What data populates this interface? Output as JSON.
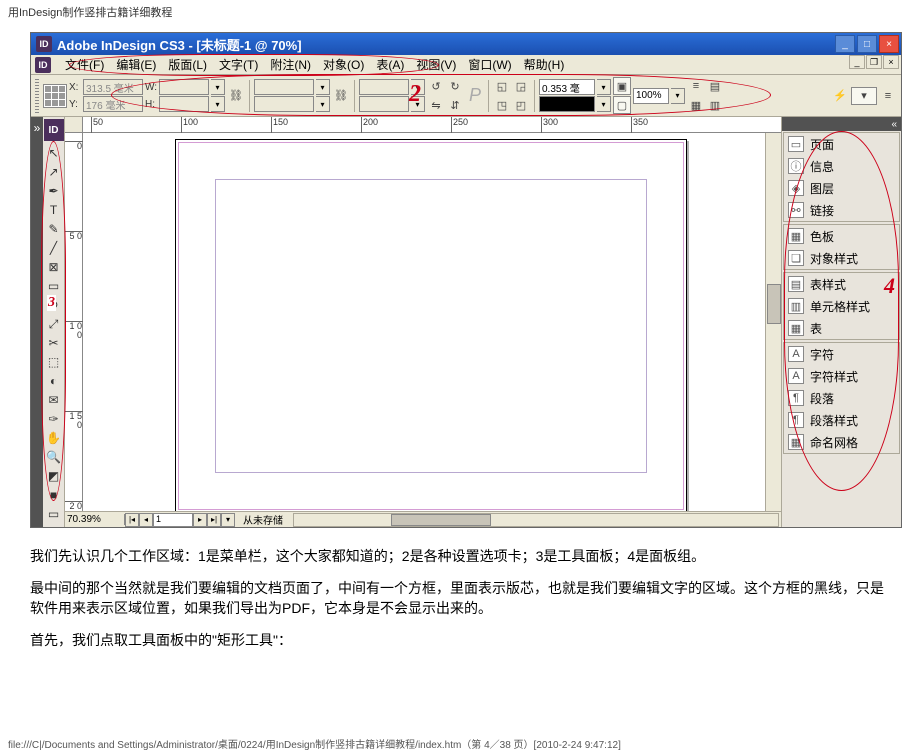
{
  "page_title": "用InDesign制作竖排古籍详细教程",
  "titlebar": {
    "app_name": "Adobe InDesign CS3 - [未标题-1 @ 70%]"
  },
  "win_controls": {
    "min": "_",
    "max": "□",
    "close": "×"
  },
  "mdi_controls": {
    "min": "_",
    "restore": "❐",
    "close": "×"
  },
  "menu": [
    "文件(F)",
    "编辑(E)",
    "版面(L)",
    "文字(T)",
    "附注(N)",
    "对象(O)",
    "表(A)",
    "视图(V)",
    "窗口(W)",
    "帮助(H)"
  ],
  "toolbar": {
    "x_label": "X:",
    "x_value": "313.5 毫米",
    "y_label": "Y:",
    "y_value": "176 毫米",
    "w_label": "W:",
    "w_value": "",
    "h_label": "H:",
    "h_value": "",
    "opt_value": "0.353 毫",
    "zoom": "100%",
    "annotation": "2"
  },
  "ruler_h": [
    {
      "pos": 8,
      "label": "50"
    },
    {
      "pos": 98,
      "label": "100"
    },
    {
      "pos": 188,
      "label": "150"
    },
    {
      "pos": 278,
      "label": "200"
    },
    {
      "pos": 368,
      "label": "250"
    },
    {
      "pos": 458,
      "label": "300"
    },
    {
      "pos": 548,
      "label": "350"
    }
  ],
  "ruler_v": [
    {
      "pos": 8,
      "label": "0"
    },
    {
      "pos": 98,
      "label": "5\n0"
    },
    {
      "pos": 188,
      "label": "1\n0\n0"
    },
    {
      "pos": 278,
      "label": "1\n5\n0"
    },
    {
      "pos": 368,
      "label": "2\n0\n0"
    }
  ],
  "statusbar": {
    "zoom": "70.39%",
    "page": "1",
    "status": "从未存储"
  },
  "panels": {
    "group1": [
      {
        "icon": "▭",
        "label": "页面"
      },
      {
        "icon": "ⓘ",
        "label": "信息"
      },
      {
        "icon": "◈",
        "label": "图层"
      },
      {
        "icon": "⚯",
        "label": "链接"
      }
    ],
    "group2": [
      {
        "icon": "▦",
        "label": "色板"
      },
      {
        "icon": "❏",
        "label": "对象样式"
      }
    ],
    "group3": [
      {
        "icon": "▤",
        "label": "表样式"
      },
      {
        "icon": "▥",
        "label": "单元格样式"
      },
      {
        "icon": "▦",
        "label": "表"
      }
    ],
    "group4": [
      {
        "icon": "A",
        "label": "字符"
      },
      {
        "icon": "A",
        "label": "字符样式"
      },
      {
        "icon": "¶",
        "label": "段落"
      },
      {
        "icon": "¶",
        "label": "段落样式"
      },
      {
        "icon": "▦",
        "label": "命名网格"
      }
    ]
  },
  "annotations": {
    "marker2": "2",
    "marker3": "3",
    "marker4": "4"
  },
  "article": {
    "p1": "我们先认识几个工作区域：1是菜单栏，这个大家都知道的；2是各种设置选项卡；3是工具面板；4是面板组。",
    "p2": "最中间的那个当然就是我们要编辑的文档页面了，中间有一个方框，里面表示版芯，也就是我们要编辑文字的区域。这个方框的黑线，只是软件用来表示区域位置，如果我们导出为PDF，它本身是不会显示出来的。",
    "p3": "首先，我们点取工具面板中的\"矩形工具\"："
  },
  "footer": "file:///C|/Documents and Settings/Administrator/桌面/0224/用InDesign制作竖排古籍详细教程/index.htm（第 4／38 页）[2010-2-24 9:47:12]"
}
